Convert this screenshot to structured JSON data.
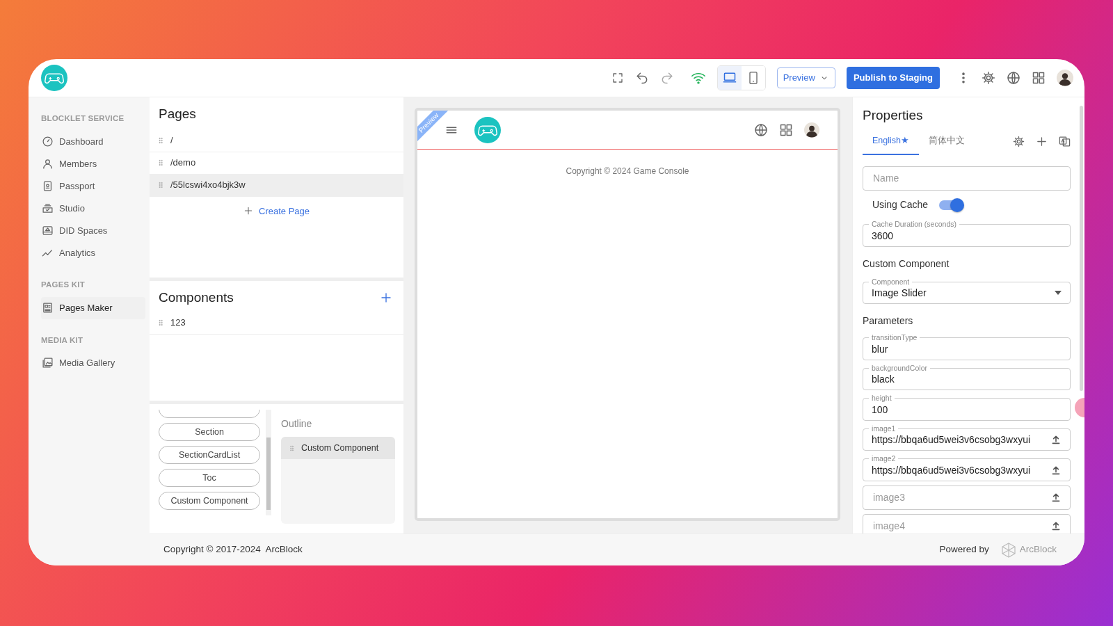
{
  "header": {
    "devices": [
      {
        "kind": "desktop",
        "selected": true
      },
      {
        "kind": "mobile",
        "selected": false
      }
    ],
    "preview_button": "Preview",
    "publish_button": "Publish to Staging"
  },
  "sidebar": {
    "sections": [
      {
        "title": "BLOCKLET SERVICE",
        "items": [
          {
            "label": "Dashboard",
            "selected": false
          },
          {
            "label": "Members",
            "selected": false
          },
          {
            "label": "Passport",
            "selected": false
          },
          {
            "label": "Studio",
            "selected": false
          },
          {
            "label": "DID Spaces",
            "selected": false
          },
          {
            "label": "Analytics",
            "selected": false
          }
        ]
      },
      {
        "title": "PAGES KIT",
        "items": [
          {
            "label": "Pages Maker",
            "selected": true
          }
        ]
      },
      {
        "title": "MEDIA KIT",
        "items": [
          {
            "label": "Media Gallery",
            "selected": false
          }
        ]
      }
    ]
  },
  "pages": {
    "title": "Pages",
    "items": [
      {
        "path": "/",
        "selected": false
      },
      {
        "path": "/demo",
        "selected": false
      },
      {
        "path": "/55lcswi4xo4bjk3w",
        "selected": true
      }
    ],
    "create_label": "Create Page"
  },
  "components": {
    "title": "Components",
    "items": [
      "123"
    ]
  },
  "palette": {
    "items": [
      "Section",
      "SectionCardList",
      "Toc",
      "Custom Component"
    ]
  },
  "outline": {
    "title": "Outline",
    "items": [
      {
        "label": "Custom Component",
        "selected": true
      }
    ]
  },
  "preview": {
    "ribbon": "Preview",
    "copyright": "Copyright © 2024 Game Console"
  },
  "properties": {
    "title": "Properties",
    "tabs": [
      {
        "label": "English★",
        "selected": true
      },
      {
        "label": "简体中文",
        "selected": false
      }
    ],
    "name_field": {
      "placeholder": "Name"
    },
    "cache": {
      "label": "Using Cache",
      "on": true
    },
    "cache_duration": {
      "label": "Cache Duration (seconds)",
      "value": "3600"
    },
    "section_title": "Custom Component",
    "component": {
      "label": "Component",
      "value": "Image Slider"
    },
    "parameters_title": "Parameters",
    "parameters": [
      {
        "kind": "text",
        "label": "transitionType",
        "value": "blur"
      },
      {
        "kind": "text",
        "label": "backgroundColor",
        "value": "black"
      },
      {
        "kind": "text",
        "label": "height",
        "value": "100"
      },
      {
        "kind": "upload",
        "label": "image1",
        "value": "https://bbqa6ud5wei3v6csobg3wxyui"
      },
      {
        "kind": "upload",
        "label": "image2",
        "value": "https://bbqa6ud5wei3v6csobg3wxyui"
      },
      {
        "kind": "upload",
        "placeholder": "image3"
      },
      {
        "kind": "upload",
        "placeholder": "image4"
      }
    ]
  },
  "footer": {
    "copyright": "Copyright © 2017-2024  ArcBlock",
    "powered_by": "Powered by",
    "brand": "ArcBlock"
  }
}
